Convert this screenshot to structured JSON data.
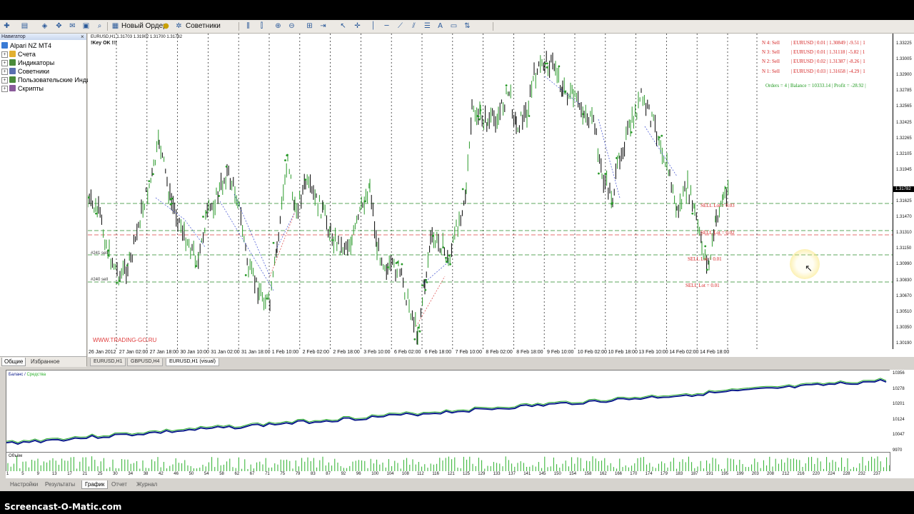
{
  "toolbar": {
    "new_order": "Новый Ордер",
    "experts": "Советники"
  },
  "navigator": {
    "title": "Навигатор",
    "root": "Alpari NZ MT4",
    "items": [
      "Счета",
      "Индикаторы",
      "Советники",
      "Пользовательские Инди",
      "Скрипты"
    ],
    "tabs": [
      "Общие",
      "Избранное"
    ]
  },
  "chart": {
    "symbol_header": "EURUSD,H1  1.31703 1.31902 1.31700 1.31782",
    "status": "!Key OK !!!",
    "website": "WWW.TRADING-GO.RU",
    "label_241": "#241 sell",
    "label_240": "#240 sell",
    "current_price": "1.31782",
    "price_labels": [
      "1.33225",
      "1.33005",
      "1.32900",
      "1.32785",
      "1.32565",
      "1.32425",
      "1.32265",
      "1.32105",
      "1.31945",
      "1.31782",
      "1.31625",
      "1.31470",
      "1.31310",
      "1.31150",
      "1.30990",
      "1.30830",
      "1.30670",
      "1.30510",
      "1.30350",
      "1.30190"
    ],
    "time_labels": [
      "26 Jan 2012",
      "27 Jan 02:00",
      "27 Jan 18:00",
      "30 Jan 10:00",
      "31 Jan 02:00",
      "31 Jan 18:00",
      "1 Feb 10:00",
      "2 Feb 02:00",
      "2 Feb 18:00",
      "3 Feb 10:00",
      "6 Feb 02:00",
      "6 Feb 18:00",
      "7 Feb 10:00",
      "8 Feb 02:00",
      "8 Feb 18:00",
      "9 Feb 10:00",
      "10 Feb 02:00",
      "10 Feb 18:00",
      "13 Feb 10:00",
      "14 Feb 02:00",
      "14 Feb 18:00"
    ],
    "orders": [
      {
        "id": "N 4: Sell",
        "detail": "| EURUSD | 0.01 | 1.30849 | -9.51 | 1"
      },
      {
        "id": "N 3: Sell",
        "detail": "| EURUSD | 0.01 | 1.31118 | -5.82 | 1"
      },
      {
        "id": "N 2: Sell",
        "detail": "| EURUSD | 0.02 | 1.31387 | -8.26 | 1"
      },
      {
        "id": "N 1: Sell",
        "detail": "| EURUSD | 0.03 | 1.31658 | -4.29 | 1"
      }
    ],
    "summary": "Orders = 4 | Balance = 10333.14 |  Profit = -28.92 |",
    "sell_levels": [
      "SELL Lot = 0.03",
      "SELL Lot = 0.02",
      "SELL Lot = 0.01",
      "SELL Lot = 0.01"
    ]
  },
  "chart_tabs": [
    "EURUSD,H1",
    "GBPUSD,H4",
    "EURUSD,H1 (visual)"
  ],
  "tester": {
    "legend_balance": "Баланс",
    "legend_sep": " / ",
    "legend_equity": "Средства",
    "volume_label": "Объём",
    "balance_scale": [
      "10356",
      "10278",
      "10201",
      "10124",
      "10047",
      "9970"
    ],
    "x_ticks": [
      "1",
      "5",
      "9",
      "13",
      "17",
      "21",
      "25",
      "30",
      "34",
      "38",
      "42",
      "46",
      "50",
      "54",
      "58",
      "62",
      "67",
      "71",
      "75",
      "79",
      "83",
      "87",
      "92",
      "96",
      "100",
      "104",
      "108",
      "112",
      "116",
      "121",
      "125",
      "129",
      "133",
      "137",
      "141",
      "145",
      "150",
      "154",
      "158",
      "162",
      "166",
      "170",
      "174",
      "179",
      "183",
      "187",
      "191",
      "195",
      "199",
      "203",
      "208",
      "212",
      "216",
      "220",
      "224",
      "228",
      "232",
      "237"
    ],
    "tabs": [
      "Настройки",
      "Результаты",
      "График",
      "Отчет",
      "Журнал"
    ]
  },
  "watermark": "Screencast-O-Matic.com",
  "colors": {
    "bull_tick": "#2a9a2a",
    "bear_tick": "#000000",
    "balance": "#0a1a8a",
    "equity": "#2bb02b",
    "order_text": "#d42020"
  }
}
